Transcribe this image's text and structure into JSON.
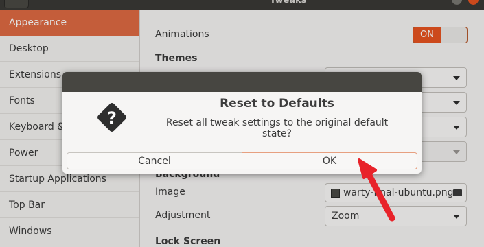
{
  "header": {
    "title": "Tweaks"
  },
  "sidebar": {
    "items": [
      {
        "label": "Appearance"
      },
      {
        "label": "Desktop"
      },
      {
        "label": "Extensions"
      },
      {
        "label": "Fonts"
      },
      {
        "label": "Keyboard & Mouse"
      },
      {
        "label": "Power"
      },
      {
        "label": "Startup Applications"
      },
      {
        "label": "Top Bar"
      },
      {
        "label": "Windows"
      }
    ],
    "selected": "Appearance"
  },
  "main": {
    "animations_label": "Animations",
    "animations_toggle": "ON",
    "themes_title": "Themes",
    "background_title": "Background",
    "image_label": "Image",
    "image_value": "warty-final-ubuntu.png",
    "adjustment_label": "Adjustment",
    "adjustment_value": "Zoom",
    "lock_screen_title": "Lock Screen"
  },
  "dialog": {
    "title": "Reset to Defaults",
    "message": "Reset all tweak settings to the original default state?",
    "cancel_label": "Cancel",
    "ok_label": "OK",
    "icon": "question-icon"
  },
  "annotation": {
    "color": "#e8232a",
    "icon": "red-arrow"
  },
  "colors": {
    "accent": "#e95420",
    "sidebar_selected": "#e06a43"
  }
}
